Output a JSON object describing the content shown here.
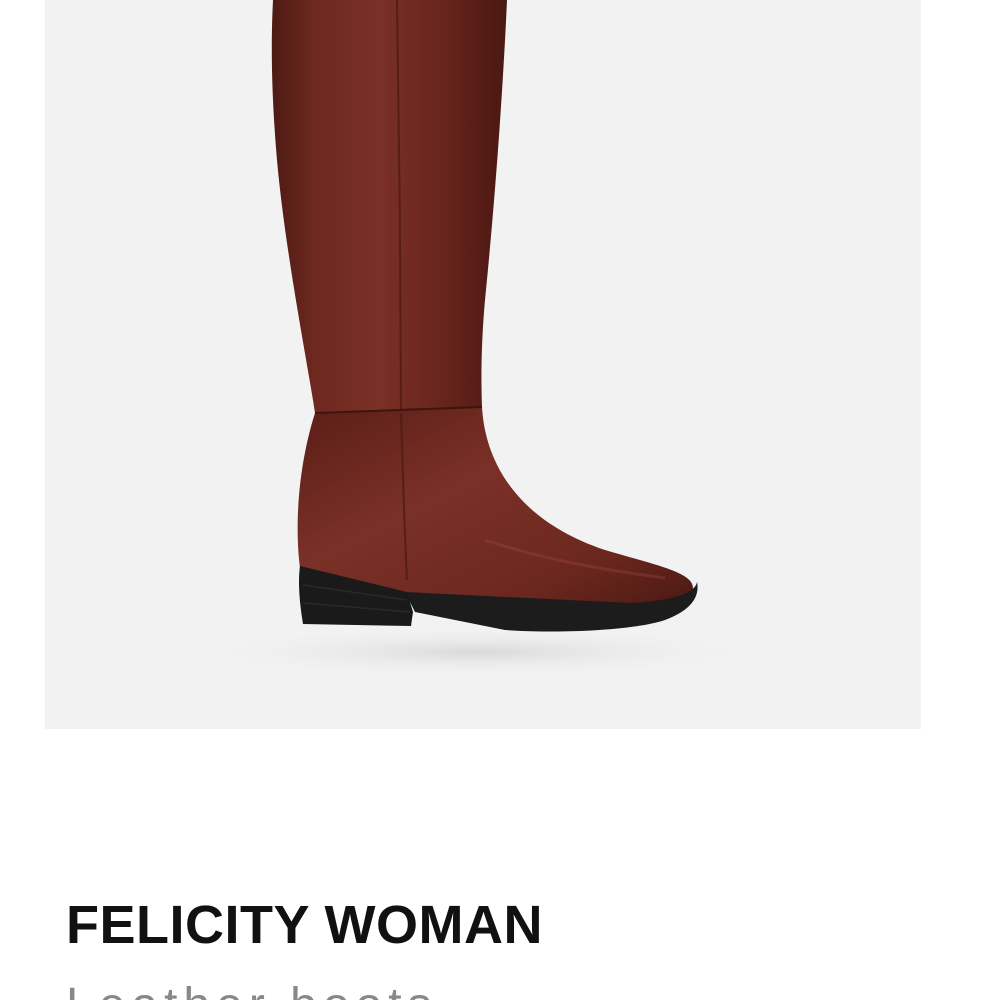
{
  "product": {
    "image_alt": "FELICITY WOMAN",
    "name": "FELICITY WOMAN",
    "description": "Leather boots"
  },
  "colors": {
    "image_background": "#f2f2f2",
    "boot_leather": "#6e2a22",
    "boot_sole": "#1c1c1c",
    "title_text": "#111111",
    "subtitle_text": "#888888"
  }
}
